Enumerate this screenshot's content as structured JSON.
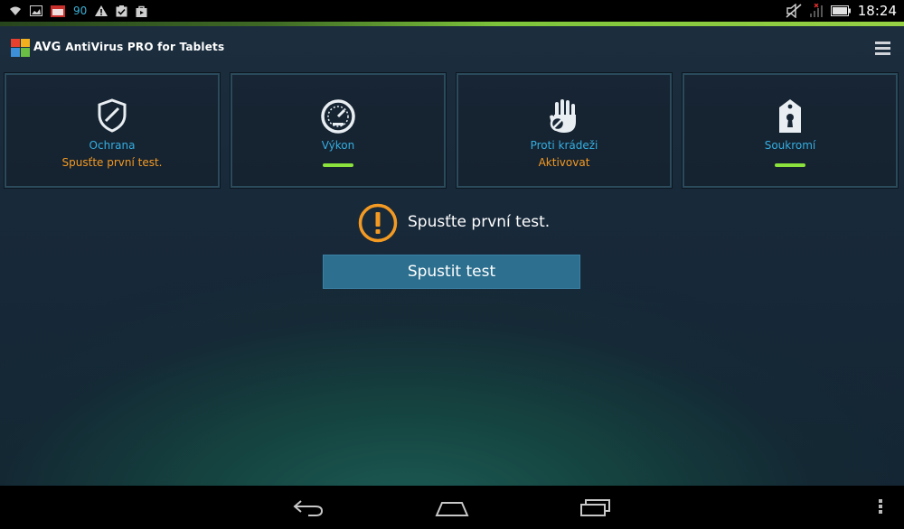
{
  "status_bar": {
    "icons_left": [
      "wifi-icon",
      "image-icon",
      "calendar-icon",
      "warning-icon",
      "clipboard-icon",
      "bag-icon"
    ],
    "battery_count": "90",
    "icons_right": [
      "mute-icon",
      "no-signal-icon",
      "battery-icon"
    ],
    "time": "18:24"
  },
  "action_bar": {
    "brand": "AVG",
    "app_title": "AntiVirus PRO for Tablets",
    "menu_icon": "hamburger-icon"
  },
  "tiles": [
    {
      "icon": "shield-icon",
      "label": "Ochrana",
      "status": "Spusťte první test.",
      "status_color": "#f49a22",
      "ok": false
    },
    {
      "icon": "speedometer-icon",
      "label": "Výkon",
      "status": "",
      "ok": true
    },
    {
      "icon": "hand-icon",
      "label": "Proti krádeži",
      "status": "Aktivovat",
      "status_color": "#f49a22",
      "ok": false
    },
    {
      "icon": "tag-lock-icon",
      "label": "Soukromí",
      "status": "",
      "ok": true
    }
  ],
  "alert": {
    "icon": "exclamation-circle-icon",
    "message": "Spusťte první test.",
    "button_label": "Spustit test"
  },
  "colors": {
    "accent_blue": "#35aee0",
    "warning_orange": "#f49a22",
    "ok_green": "#8ce23c",
    "button_blue": "#2d6f8f"
  },
  "nav_bar": {
    "buttons": [
      "back-icon",
      "home-icon",
      "recents-icon",
      "overflow-icon"
    ]
  }
}
